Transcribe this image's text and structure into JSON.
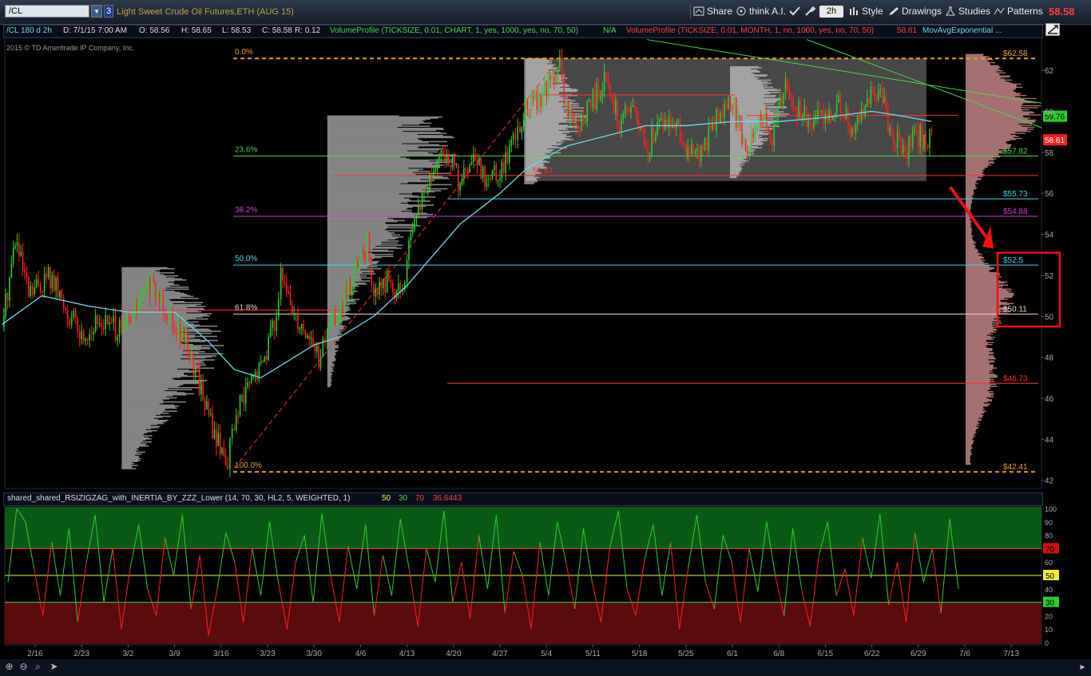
{
  "toolbar": {
    "symbol": "/CL",
    "link_group": "3",
    "instrument_desc": "Light Sweet Crude Oil Futures,ETH (AUG 15)",
    "share_label": "Share",
    "thinkai_label": "think A.I.",
    "timeframe": "2h",
    "style_label": "Style",
    "drawings_label": "Drawings",
    "studies_label": "Studies",
    "patterns_label": "Patterns",
    "last_price": "58.58"
  },
  "status": {
    "desc": "/CL 180 d 2h",
    "date": "D: 7/1/15 7:00 AM",
    "open": "O: 58.56",
    "high": "H: 58.65",
    "low": "L: 58.53",
    "close": "C: 58.58",
    "range": "R: 0.12",
    "vp_chart": "VolumeProfile (TICKSIZE, 0.01, CHART, 1, yes, 1000, yes, no, 70, 50)",
    "vp_chart_val": "N/A",
    "vp_month": "VolumeProfile (TICKSIZE, 0.01, MONTH, 1, no, 1000, yes, no, 70, 50)",
    "vp_month_val": "58.61",
    "mov_avg": "MovAvgExponential ..."
  },
  "copyright": "2015 © TD Ameritrade IP Company, Inc.",
  "lower": {
    "study": "shared_shared_RSIZIGZAG_with_INERTIA_BY_ZZZ_Lower (14, 70, 30, HL2, 5, WEIGHTED, 1)",
    "v50": "50",
    "v30": "30",
    "v70": "70",
    "value": "36.6443"
  },
  "colors": {
    "up": "#2ecc2e",
    "down": "#ff2020",
    "ema": "#6fd8e8",
    "fib_gold": "#e8a020",
    "volume_profile": "#8a8a8a",
    "annotation": "#ee1111"
  },
  "chart_data": [
    {
      "type": "candlestick",
      "instrument": "/CL",
      "x_ticks": [
        "2/16",
        "2/23",
        "3/2",
        "3/9",
        "3/16",
        "3/23",
        "3/30",
        "4/6",
        "4/13",
        "4/20",
        "4/27",
        "5/4",
        "5/11",
        "5/18",
        "5/25",
        "6/1",
        "6/8",
        "6/15",
        "6/22",
        "6/29",
        "7/6",
        "7/13"
      ],
      "y_ticks": [
        42,
        44,
        46,
        48,
        50,
        52,
        54,
        56,
        58,
        60,
        62
      ],
      "ylim": [
        41.6,
        63.6
      ],
      "path": [
        [
          "2/11",
          49.5
        ],
        [
          "2/13",
          53.8
        ],
        [
          "2/15",
          51.0
        ],
        [
          "2/18",
          52.0
        ],
        [
          "2/20",
          50.8
        ],
        [
          "2/23",
          49.0
        ],
        [
          "2/26",
          49.8
        ],
        [
          "3/1",
          49.2
        ],
        [
          "3/3",
          50.2
        ],
        [
          "3/5",
          51.5
        ],
        [
          "3/7",
          50.8
        ],
        [
          "3/9",
          49.8
        ],
        [
          "3/11",
          48.5
        ],
        [
          "3/13",
          46.5
        ],
        [
          "3/15",
          44.2
        ],
        [
          "3/17",
          43.0
        ],
        [
          "3/18",
          44.8
        ],
        [
          "3/20",
          46.5
        ],
        [
          "3/22",
          47.5
        ],
        [
          "3/24",
          49.8
        ],
        [
          "3/25",
          51.8
        ],
        [
          "3/27",
          50.2
        ],
        [
          "3/29",
          49.2
        ],
        [
          "3/31",
          47.8
        ],
        [
          "4/1",
          49.5
        ],
        [
          "4/3",
          50.2
        ],
        [
          "4/5",
          52.0
        ],
        [
          "4/7",
          53.5
        ],
        [
          "4/8",
          51.0
        ],
        [
          "4/10",
          51.8
        ],
        [
          "4/12",
          51.0
        ],
        [
          "4/13",
          52.8
        ],
        [
          "4/15",
          55.5
        ],
        [
          "4/17",
          57.0
        ],
        [
          "4/19",
          58.0
        ],
        [
          "4/21",
          56.5
        ],
        [
          "4/23",
          57.5
        ],
        [
          "4/25",
          56.8
        ],
        [
          "4/27",
          57.2
        ],
        [
          "4/29",
          58.5
        ],
        [
          "4/30",
          59.5
        ],
        [
          "5/2",
          60.5
        ],
        [
          "5/4",
          61.0
        ],
        [
          "5/6",
          62.2
        ],
        [
          "5/7",
          60.0
        ],
        [
          "5/9",
          59.2
        ],
        [
          "5/11",
          60.5
        ],
        [
          "5/13",
          61.5
        ],
        [
          "5/15",
          59.5
        ],
        [
          "5/17",
          60.2
        ],
        [
          "5/19",
          58.0
        ],
        [
          "5/21",
          59.5
        ],
        [
          "5/23",
          59.8
        ],
        [
          "5/25",
          58.2
        ],
        [
          "5/27",
          57.5
        ],
        [
          "5/29",
          59.5
        ],
        [
          "6/1",
          60.5
        ],
        [
          "6/3",
          58.0
        ],
        [
          "6/5",
          60.0
        ],
        [
          "6/7",
          58.5
        ],
        [
          "6/9",
          61.5
        ],
        [
          "6/11",
          60.0
        ],
        [
          "6/13",
          59.5
        ],
        [
          "6/15",
          59.8
        ],
        [
          "6/17",
          60.5
        ],
        [
          "6/19",
          59.0
        ],
        [
          "6/21",
          60.5
        ],
        [
          "6/23",
          61.0
        ],
        [
          "6/25",
          59.0
        ],
        [
          "6/27",
          58.0
        ],
        [
          "6/29",
          58.8
        ],
        [
          "7/1",
          58.58
        ]
      ],
      "ema": [
        [
          "2/11",
          49.6
        ],
        [
          "2/17",
          51.0
        ],
        [
          "2/24",
          50.5
        ],
        [
          "3/2",
          50.2
        ],
        [
          "3/9",
          50.2
        ],
        [
          "3/14",
          48.8
        ],
        [
          "3/18",
          47.4
        ],
        [
          "3/22",
          47.0
        ],
        [
          "3/25",
          47.6
        ],
        [
          "3/30",
          48.6
        ],
        [
          "4/3",
          49.0
        ],
        [
          "4/8",
          50.0
        ],
        [
          "4/13",
          51.5
        ],
        [
          "4/17",
          53.0
        ],
        [
          "4/21",
          54.5
        ],
        [
          "4/27",
          56.0
        ],
        [
          "5/1",
          57.2
        ],
        [
          "5/7",
          58.3
        ],
        [
          "5/13",
          58.8
        ],
        [
          "5/19",
          59.3
        ],
        [
          "5/25",
          59.3
        ],
        [
          "6/1",
          59.5
        ],
        [
          "6/8",
          59.5
        ],
        [
          "6/15",
          59.7
        ],
        [
          "6/22",
          60.0
        ],
        [
          "6/26",
          59.8
        ],
        [
          "7/1",
          59.5
        ]
      ],
      "fib_levels": [
        {
          "label": "0.0%",
          "price": 62.58,
          "price_label": "$62.58",
          "color": "#e8a020",
          "dashed": true
        },
        {
          "label": "23.6%",
          "price": 57.82,
          "price_label": "$57.82",
          "color": "#4ad84a",
          "dashed": false
        },
        {
          "label": "38.2%",
          "price": 54.88,
          "price_label": "$54.88",
          "color": "#d040d0",
          "dashed": false
        },
        {
          "label": "50.0%",
          "price": 52.5,
          "price_label": "$52.5",
          "color": "#40d8e8",
          "dashed": false
        },
        {
          "label": "61.8%",
          "price": 50.11,
          "price_label": "$50.11",
          "color": "#f0d0c0",
          "dashed": false
        },
        {
          "label": "100.0%",
          "price": 42.41,
          "price_label": "$42.41",
          "color": "#e8a020",
          "dashed": true
        }
      ],
      "other_levels": [
        {
          "price": 56.87,
          "label": "56.87",
          "color": "#ff3030"
        },
        {
          "price": 55.73,
          "label": "$55.73",
          "color": "#40d8e8"
        },
        {
          "price": 46.73,
          "label": "$46.73",
          "color": "#ff3030"
        }
      ],
      "right_price_labels": [
        {
          "price": 59.76,
          "text": "59.76",
          "bg": "#2ecc2e",
          "fg": "#000"
        },
        {
          "price": 58.61,
          "text": "58.61",
          "bg": "#ff2020",
          "fg": "#fff"
        }
      ]
    },
    {
      "type": "line",
      "name": "RSI ZigZag Lower",
      "ylim": [
        0,
        100
      ],
      "y_ticks": [
        0,
        10,
        20,
        30,
        40,
        50,
        60,
        70,
        80,
        90,
        100
      ],
      "levels": [
        {
          "value": 70,
          "label": "70"
        },
        {
          "value": 50,
          "label": "50"
        },
        {
          "value": 30,
          "label": "30"
        }
      ],
      "values": [
        45,
        100,
        90,
        55,
        20,
        75,
        35,
        85,
        15,
        60,
        95,
        30,
        70,
        10,
        55,
        88,
        40,
        20,
        78,
        50,
        95,
        25,
        65,
        5,
        40,
        82,
        60,
        15,
        70,
        35,
        90,
        45,
        10,
        60,
        80,
        30,
        96,
        50,
        15,
        72,
        40,
        88,
        20,
        65,
        35,
        92,
        55,
        12,
        70,
        45,
        98,
        30,
        60,
        18,
        80,
        40,
        95,
        22,
        68,
        50,
        10,
        75,
        35,
        90,
        60,
        25,
        85,
        45,
        15,
        70,
        98,
        40,
        20,
        62,
        88,
        35,
        75,
        10,
        55,
        95,
        45,
        25,
        80,
        60,
        15,
        70,
        38,
        90,
        50,
        20,
        85,
        40,
        12,
        65,
        90,
        35,
        55,
        20,
        78,
        48,
        96,
        28,
        60,
        15,
        82,
        45,
        70,
        22,
        92,
        40
      ]
    }
  ]
}
